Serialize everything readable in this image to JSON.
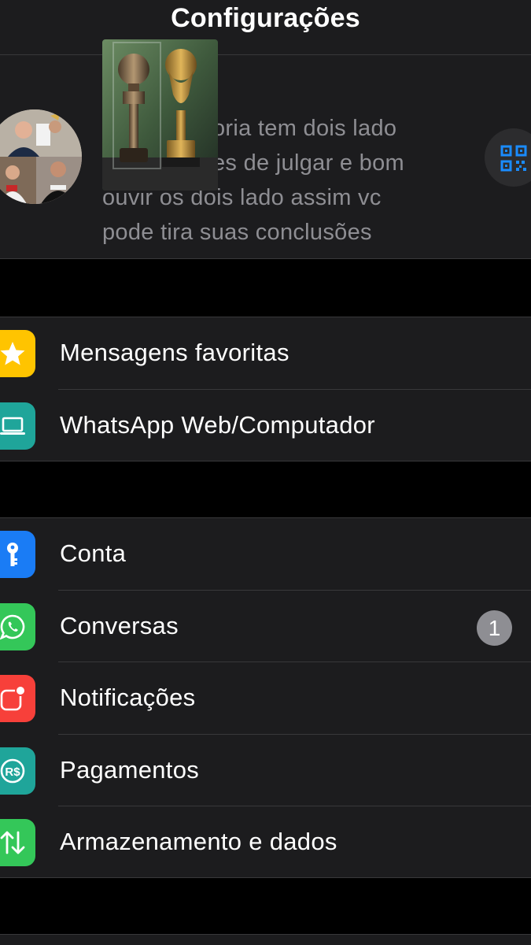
{
  "header": {
    "title": "Configurações"
  },
  "profile": {
    "status_lines": [
      "A história tem dois lado",
      "antes de julgar e bom",
      "ouvir os dois lado assim vc",
      "pode tira suas conclusões"
    ],
    "status_visible_fragments": [
      "oria tem dois lado",
      "es de julgar e bom",
      "ouvir os dois lado assim vc",
      "pode tira suas conclusões"
    ]
  },
  "groups": [
    {
      "items": [
        {
          "label": "Mensagens favoritas",
          "icon": "star-icon",
          "color": "#ffc400"
        },
        {
          "label": "WhatsApp Web/Computador",
          "icon": "laptop-icon",
          "color": "#1fa59a"
        }
      ]
    },
    {
      "items": [
        {
          "label": "Conta",
          "icon": "key-icon",
          "color": "#1a7cf5"
        },
        {
          "label": "Conversas",
          "icon": "whatsapp-icon",
          "color": "#34c759",
          "badge": "1"
        },
        {
          "label": "Notificações",
          "icon": "notification-icon",
          "color": "#f7403a"
        },
        {
          "label": "Pagamentos",
          "icon": "currency-real-icon",
          "color": "#1fa59a"
        },
        {
          "label": "Armazenamento e dados",
          "icon": "arrows-updown-icon",
          "color": "#34c759"
        }
      ]
    }
  ],
  "colors": {
    "background": "#000000",
    "cell": "#1c1c1e",
    "separator": "#38383a",
    "secondary_text": "#8e8e93",
    "accent_qr": "#1a8cff"
  }
}
